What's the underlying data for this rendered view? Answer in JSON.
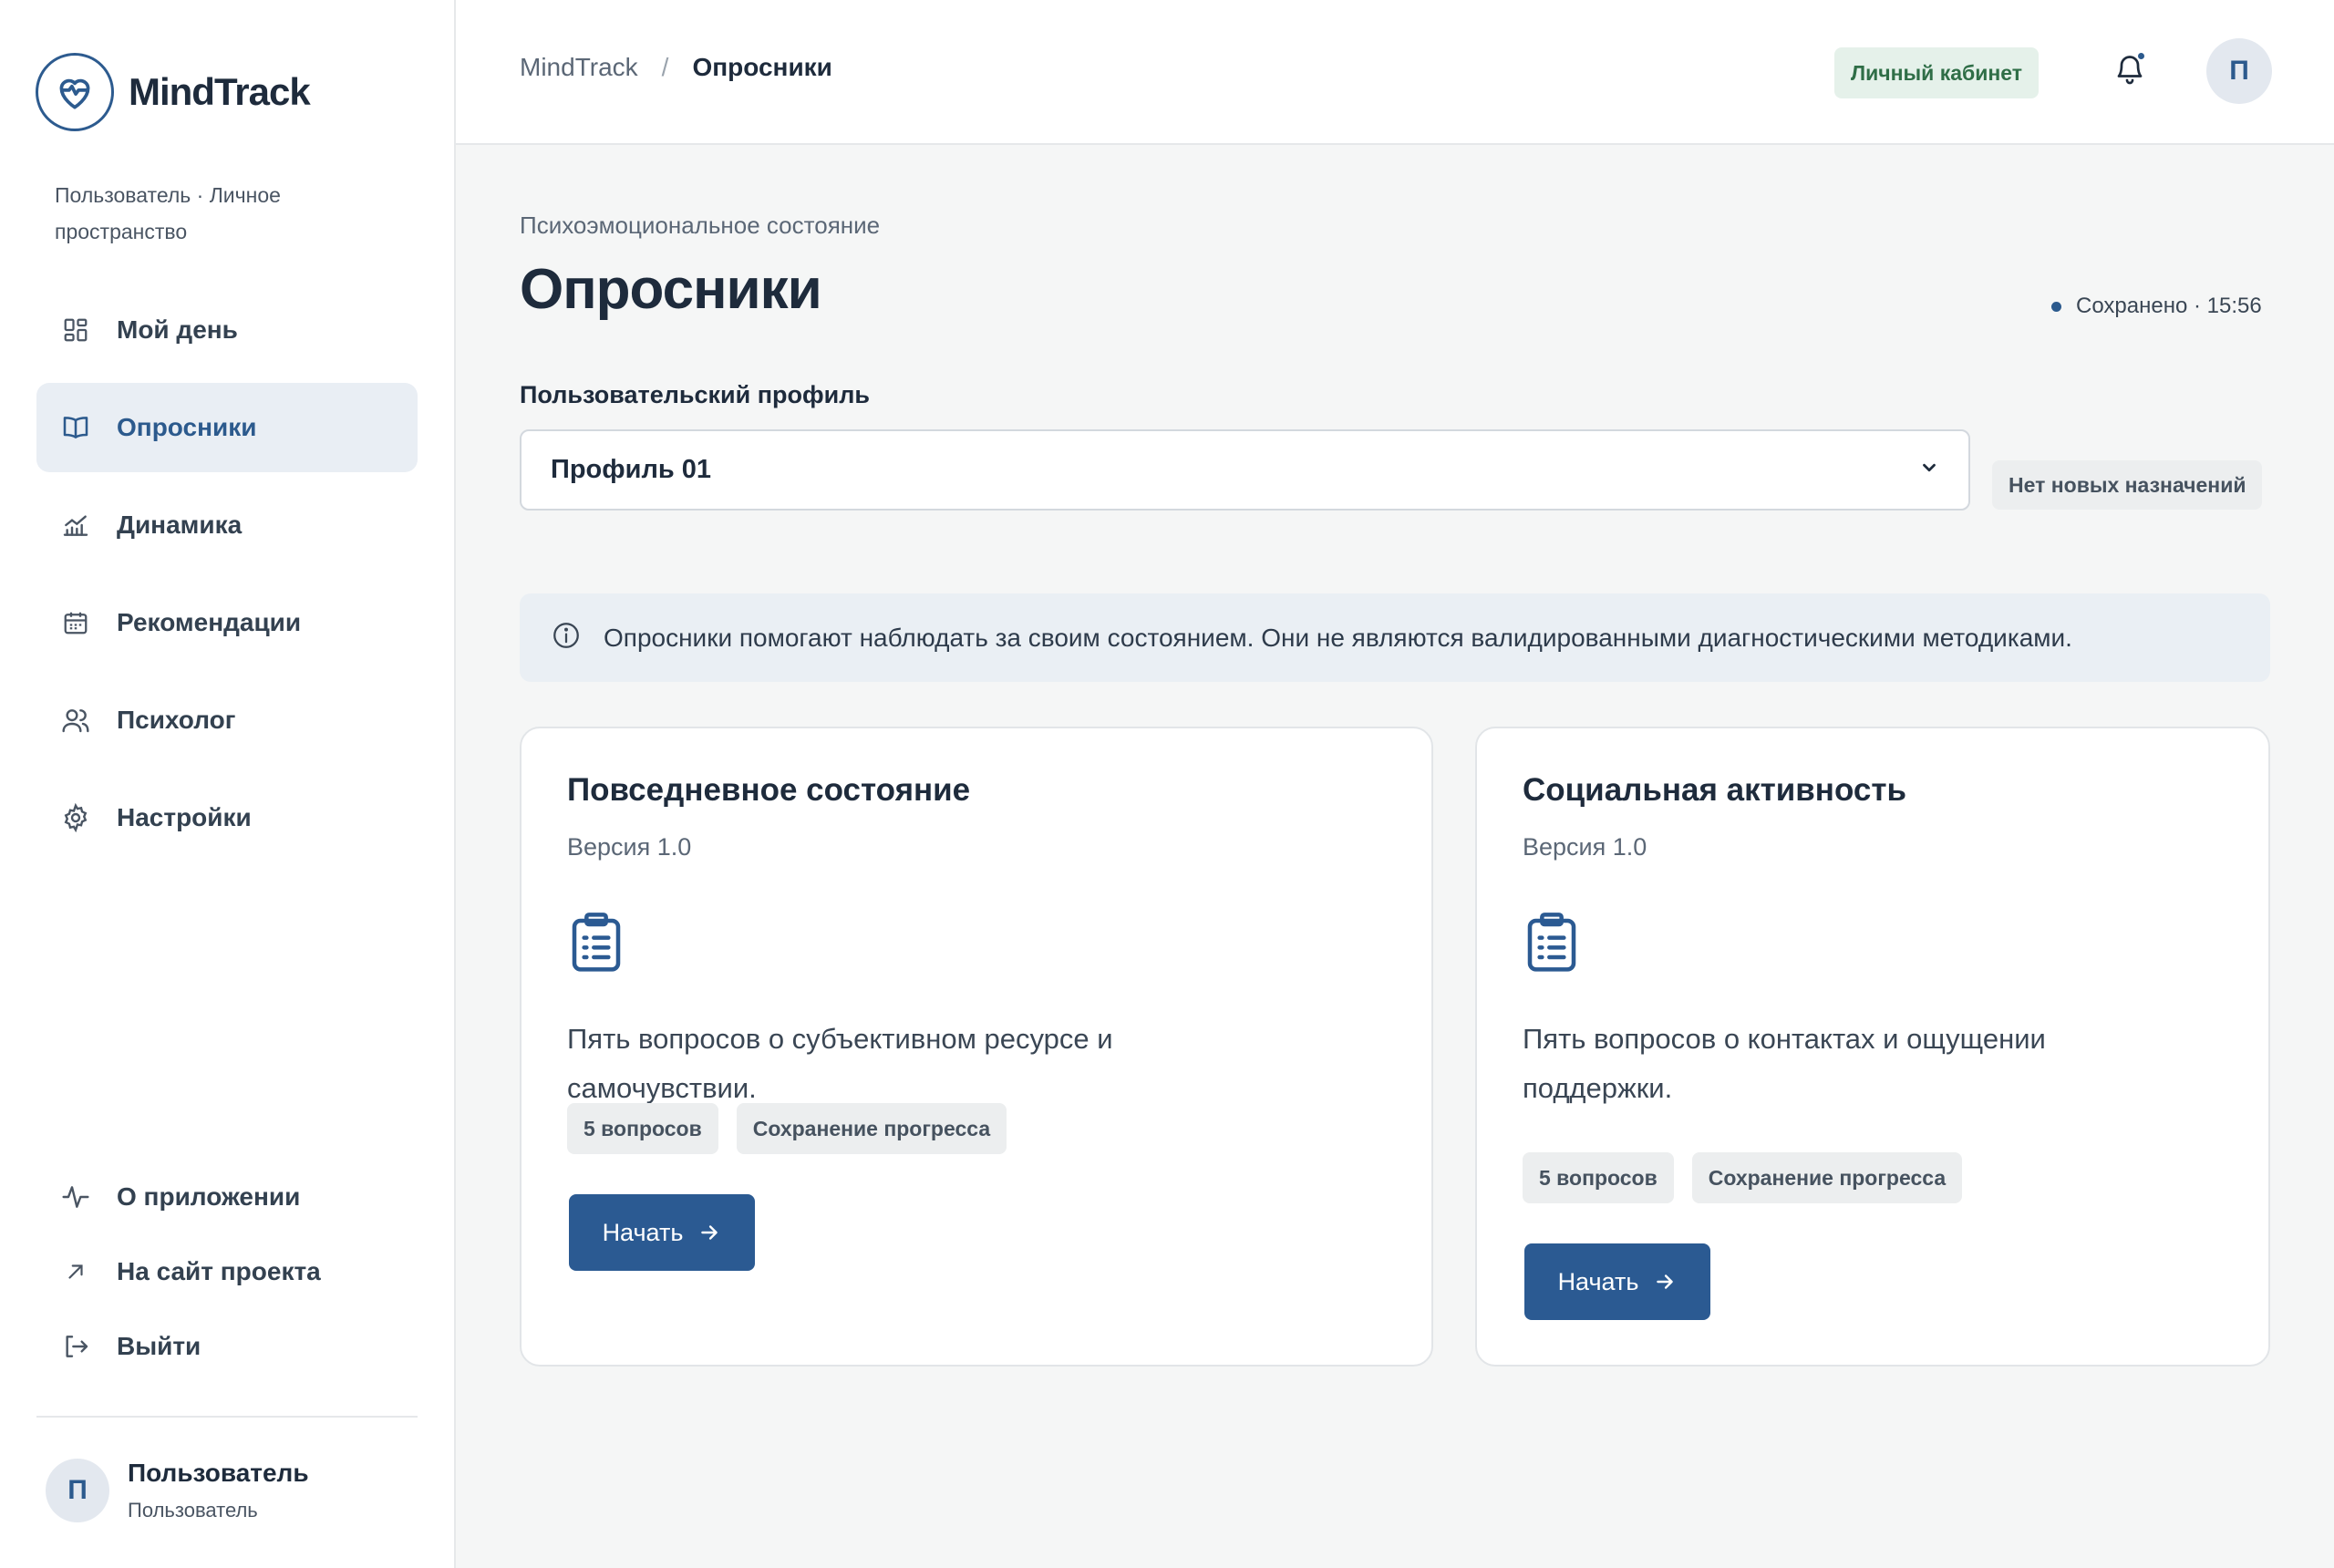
{
  "brand": {
    "name": "MindTrack"
  },
  "sidebar": {
    "context": "Пользователь · Личное пространство",
    "nav": [
      {
        "label": "Мой день",
        "icon": "grid-icon"
      },
      {
        "label": "Опросники",
        "icon": "book-icon",
        "active": true
      },
      {
        "label": "Динамика",
        "icon": "chart-icon"
      },
      {
        "label": "Рекомендации",
        "icon": "calendar-icon"
      },
      {
        "label": "Психолог",
        "icon": "users-icon"
      },
      {
        "label": "Настройки",
        "icon": "gear-icon"
      }
    ],
    "bottom": [
      {
        "label": "О приложении",
        "icon": "pulse-icon"
      },
      {
        "label": "На сайт проекта",
        "icon": "external-arrow-icon"
      },
      {
        "label": "Выйти",
        "icon": "logout-icon"
      }
    ],
    "user": {
      "initial": "П",
      "name": "Пользователь",
      "role": "Пользователь"
    }
  },
  "topbar": {
    "breadcrumb_root": "MindTrack",
    "breadcrumb_sep": "/",
    "breadcrumb_current": "Опросники",
    "cabinet_badge": "Личный кабинет",
    "avatar_initial": "П"
  },
  "main": {
    "eyebrow": "Психоэмоциональное состояние",
    "title": "Опросники",
    "save_status": "Сохранено · 15:56",
    "profile_label": "Пользовательский профиль",
    "profile_value": "Профиль 01",
    "assign_badge": "Нет новых назначений",
    "info_text": "Опросники помогают наблюдать за своим состоянием. Они не являются валидированными диагностическими методиками."
  },
  "cards": [
    {
      "title": "Повседневное состояние",
      "version": "Версия 1.0",
      "description": "Пять вопросов о субъективном ресурсе и самочувствии.",
      "tags": [
        "5 вопросов",
        "Сохранение прогресса"
      ],
      "button": "Начать"
    },
    {
      "title": "Социальная активность",
      "version": "Версия 1.0",
      "description": "Пять вопросов о контактах и ощущении поддержки.",
      "tags": [
        "5 вопросов",
        "Сохранение прогресса"
      ],
      "button": "Начать"
    }
  ],
  "colors": {
    "accent": "#2b5a92",
    "success_bg": "#e5f1ea",
    "success_text": "#2f6e47"
  }
}
